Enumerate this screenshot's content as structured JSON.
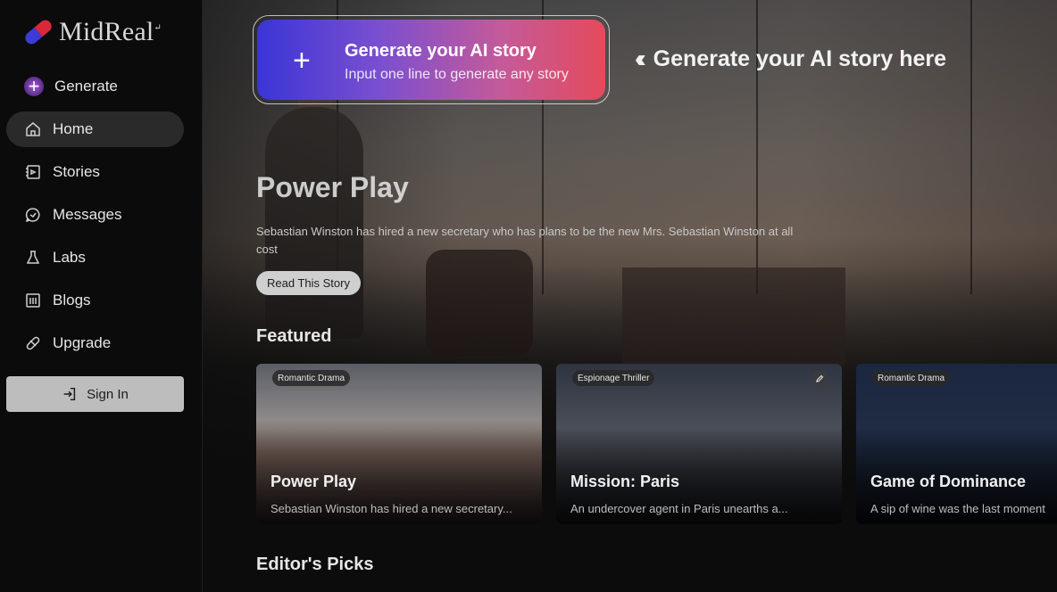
{
  "brand": {
    "name": "MidReal",
    "mark": "↵"
  },
  "sidebar": {
    "generate_label": "Generate",
    "items": [
      {
        "label": "Home",
        "icon": "home-icon",
        "active": true
      },
      {
        "label": "Stories",
        "icon": "stories-icon"
      },
      {
        "label": "Messages",
        "icon": "messages-icon"
      },
      {
        "label": "Labs",
        "icon": "flask-icon"
      },
      {
        "label": "Blogs",
        "icon": "blogs-icon"
      },
      {
        "label": "Upgrade",
        "icon": "pill-icon"
      }
    ],
    "signin_label": "Sign In"
  },
  "generate_card": {
    "plus": "+",
    "title": "Generate your AI story",
    "subtitle": "Input one line to generate any story"
  },
  "hint": {
    "chevrons": "‹‹",
    "text": "Generate your AI story here"
  },
  "hero": {
    "title": "Power Play",
    "description": "Sebastian Winston has hired a new secretary who has plans to be the new Mrs. Sebastian Winston at all cost",
    "cta": "Read This Story"
  },
  "sections": {
    "featured": "Featured",
    "editors_picks": "Editor's Picks"
  },
  "featured": [
    {
      "tag": "Romantic Drama",
      "title": "Power Play",
      "desc": "Sebastian Winston has hired a new secretary...",
      "accent": "#8a8a92"
    },
    {
      "tag": "Espionage Thriller",
      "title": "Mission: Paris",
      "desc": "An undercover agent in Paris unearths a...",
      "accent": "#3a4250"
    },
    {
      "tag": "Romantic Drama",
      "title": "Game of Dominance",
      "desc": "A sip of wine was the last moment",
      "accent": "#1a2438"
    }
  ]
}
